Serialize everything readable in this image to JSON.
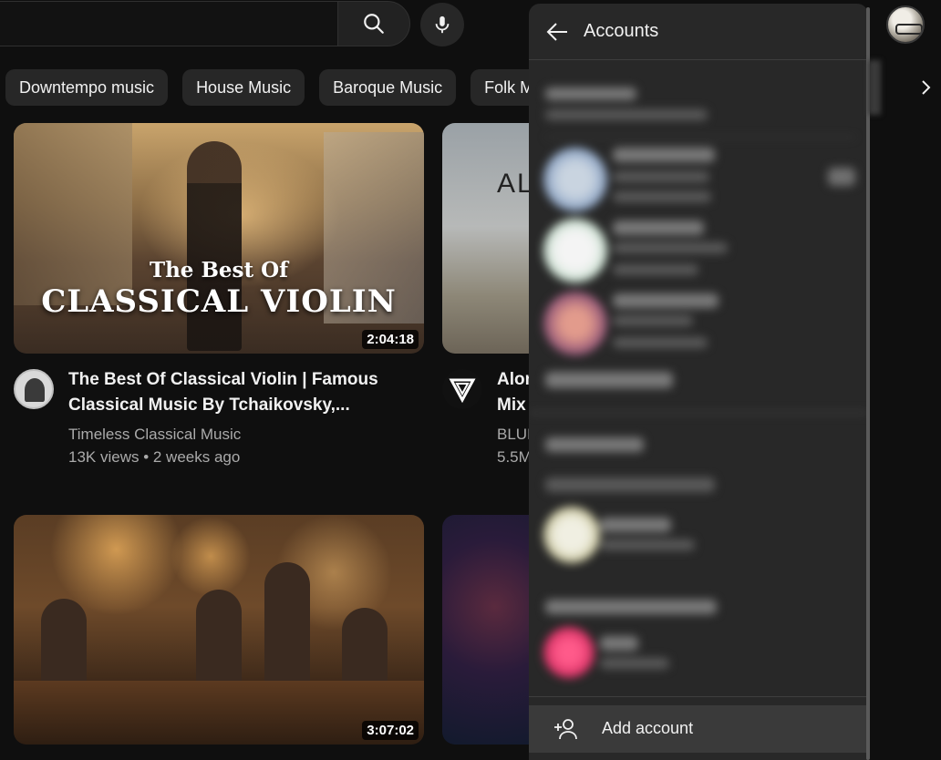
{
  "search": {
    "placeholder": ""
  },
  "chips": [
    "Downtempo music",
    "House Music",
    "Baroque Music",
    "Folk Mu"
  ],
  "videos": [
    {
      "thumb_title_small": "The Best Of",
      "thumb_title_big": "CLASSICAL VIOLIN",
      "duration": "2:04:18",
      "title_line1": "The Best Of Classical Violin | Famous",
      "title_line2": "Classical Music By Tchaikovsky,...",
      "channel": "Timeless Classical Music",
      "meta": "13K views • 2 weeks ago"
    },
    {
      "thumb_text": "AL",
      "title_line1": "Alon",
      "title_line2": "Mix",
      "channel": "BLUM",
      "meta": "5.5M"
    },
    {
      "duration": "3:07:02"
    }
  ],
  "accounts_panel": {
    "title": "Accounts",
    "add_account_label": "Add account"
  }
}
